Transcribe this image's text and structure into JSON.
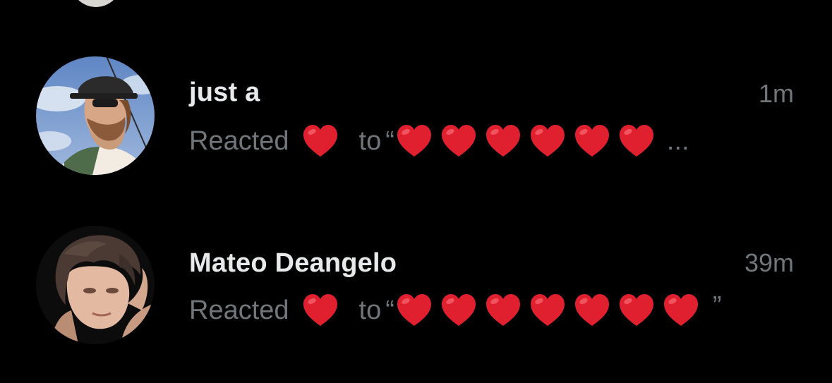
{
  "notifications": [
    {
      "name": "just a",
      "time": "1m",
      "action": "Reacted",
      "connector": "to",
      "quote_open": "“",
      "quote_close": "",
      "truncation": "...",
      "reaction_emoji": "heart-emoji",
      "quoted_heart_count": 6
    },
    {
      "name": "Mateo Deangelo",
      "time": "39m",
      "action": "Reacted",
      "connector": "to",
      "quote_open": "“",
      "quote_close": "”",
      "truncation": "",
      "reaction_emoji": "heart-emoji",
      "quoted_heart_count": 7
    }
  ],
  "colors": {
    "background": "#000000",
    "name_text": "#e7e9ea",
    "secondary_text": "#71767b",
    "heart": "#e0202f"
  }
}
